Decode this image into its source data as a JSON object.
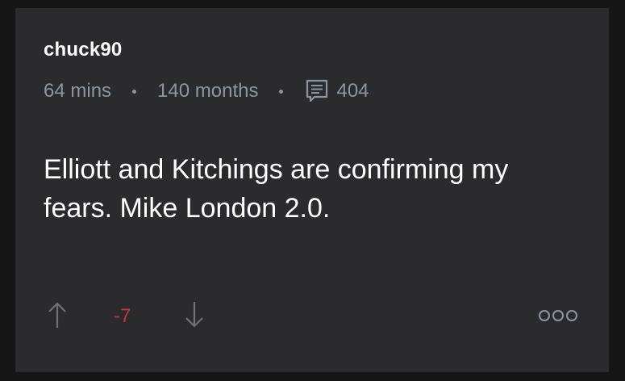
{
  "post": {
    "username": "chuck90",
    "posted_ago": "64 mins",
    "member_for": "140 months",
    "comment_count": "404",
    "body": "Elliott and Kitchings are confirming my fears. Mike London 2.0.",
    "score": "-7"
  },
  "icons": {
    "comments": "comment-bubble-icon",
    "upvote": "arrow-up-icon",
    "downvote": "arrow-down-icon",
    "more": "more-options-icon"
  },
  "colors": {
    "card_background": "#2b2a2c",
    "page_background": "#161616",
    "meta_text": "#8a96a3",
    "negative_score": "#c0383f",
    "vote_icon": "#6e7378"
  }
}
